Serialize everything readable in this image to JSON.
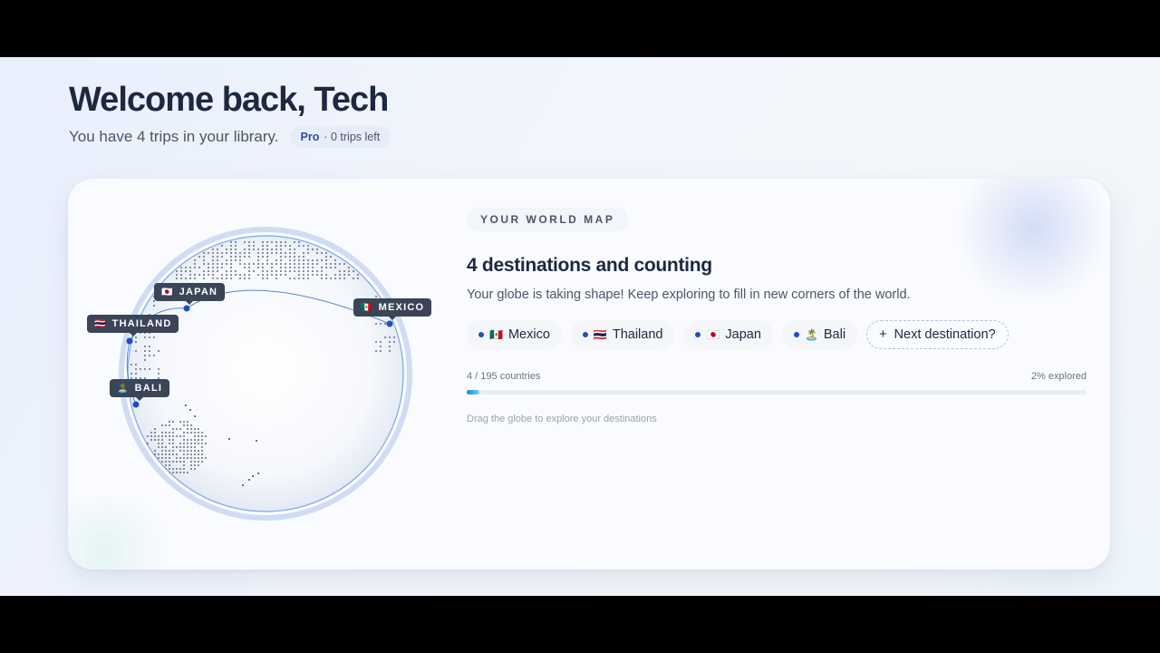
{
  "header": {
    "title": "Welcome back, Tech",
    "subtitle": "You have 4 trips in your library.",
    "plan": {
      "name": "Pro",
      "detail": "· 0 trips left"
    }
  },
  "colors": {
    "accent": "#1e4fc2",
    "heading": "#1c2940",
    "muted": "#4b5668",
    "label_bg": "#3a4558"
  },
  "globe": {
    "markers": [
      {
        "key": "japan",
        "label": "JAPAN",
        "flag": "🇯🇵"
      },
      {
        "key": "thailand",
        "label": "THAILAND",
        "flag": "🇹🇭"
      },
      {
        "key": "mexico",
        "label": "MEXICO",
        "flag": "🇲🇽"
      },
      {
        "key": "bali",
        "label": "BALI",
        "flag": "🏝️"
      }
    ]
  },
  "world_map": {
    "eyebrow": "YOUR WORLD MAP",
    "headline": "4 destinations and counting",
    "description": "Your globe is taking shape! Keep exploring to fill in new corners of the world.",
    "destinations": [
      {
        "name": "Mexico",
        "flag": "🇲🇽"
      },
      {
        "name": "Thailand",
        "flag": "🇹🇭"
      },
      {
        "name": "Japan",
        "flag": "🇯🇵"
      },
      {
        "name": "Bali",
        "flag": "🏝️"
      }
    ],
    "add_icon": "+",
    "add_label": "Next destination?",
    "progress": {
      "count_label": "4 / 195 countries",
      "percent_label": "2% explored",
      "fraction": 0.02
    },
    "hint": "Drag the globe to explore your destinations"
  }
}
